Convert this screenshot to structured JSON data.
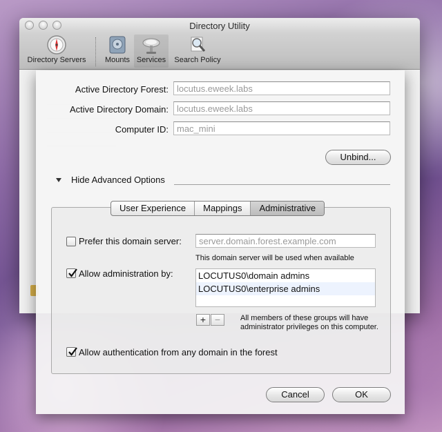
{
  "window": {
    "title": "Directory Utility",
    "toolbar": [
      {
        "label": "Directory Servers",
        "icon": "compass-icon"
      },
      {
        "label": "Mounts",
        "icon": "drive-icon"
      },
      {
        "label": "Services",
        "icon": "satellite-dish-icon"
      },
      {
        "label": "Search Policy",
        "icon": "magnifier-icon"
      }
    ]
  },
  "sheet": {
    "forest_label": "Active Directory Forest:",
    "forest_value": "locutus.eweek.labs",
    "domain_label": "Active Directory Domain:",
    "domain_value": "locutus.eweek.labs",
    "computer_id_label": "Computer ID:",
    "computer_id_value": "mac_mini",
    "unbind_label": "Unbind...",
    "advanced_label": "Hide Advanced Options",
    "tabs": [
      {
        "label": "User Experience",
        "active": false
      },
      {
        "label": "Mappings",
        "active": false
      },
      {
        "label": "Administrative",
        "active": true
      }
    ],
    "prefer_label": "Prefer this domain server:",
    "prefer_placeholder": "server.domain.forest.example.com",
    "prefer_checked": false,
    "prefer_help": "This domain server will be used when available",
    "allow_admin_label": "Allow administration by:",
    "allow_admin_checked": true,
    "admin_groups": [
      "LOCUTUS0\\domain admins",
      "LOCUTUS0\\enterprise admins"
    ],
    "add_label": "+",
    "remove_label": "−",
    "admin_help": "All members of these groups will have administrator privileges on this computer.",
    "allow_auth_label": "Allow authentication from any domain in the forest",
    "allow_auth_checked": true,
    "cancel_label": "Cancel",
    "ok_label": "OK"
  }
}
